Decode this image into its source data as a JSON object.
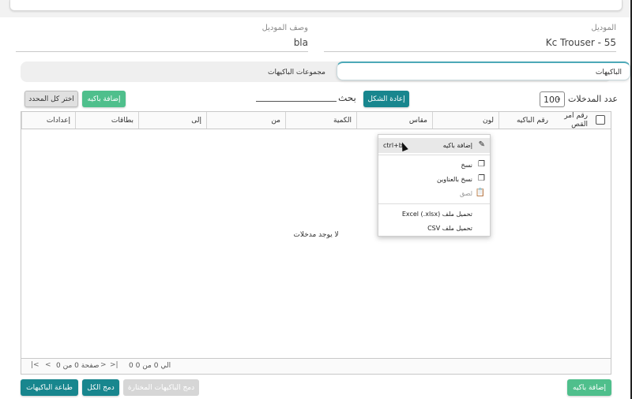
{
  "model_field": {
    "label": "الموديل",
    "value": "Kc Trouser - 55"
  },
  "model_desc_field": {
    "label": "وصف الموديل",
    "value": "bla"
  },
  "tabs": [
    {
      "label": "الباكيهات",
      "active": true
    },
    {
      "label": "مجموعات الباكيهات",
      "active": false
    }
  ],
  "toolbar": {
    "select_all_label": "اختر كل المحدد",
    "add_pack_label": "إضافة باكيه",
    "search_label": "بحث",
    "reset_label": "إعادة الشكل",
    "page_size": "100",
    "count_label": "عدد المدخلات"
  },
  "table": {
    "columns": [
      "رقم امر القص",
      "رقم الباكيه",
      "لون",
      "مقاس",
      "الكمية",
      "من",
      "إلى",
      "بطاقات",
      "إعدادات"
    ],
    "empty_text": "لا يوجد مدخلات",
    "footer": {
      "range_text": "0 الي 0 من 0",
      "page_text": "صفحة 0 من 0"
    }
  },
  "context_menu": {
    "items": [
      {
        "label": "إضافة باكيه",
        "shortcut": "ctrl+b",
        "icon": "edit-icon"
      },
      {
        "label": "نسخ",
        "icon": "copy-icon"
      },
      {
        "label": "نسخ بالعناوين",
        "icon": "copy-icon"
      },
      {
        "label": "لصق",
        "icon": "paste-icon"
      },
      {
        "label": "تحميل ملف (Excel (.xlsx"
      },
      {
        "label": "تحميل ملف CSV"
      }
    ]
  },
  "bottom_bar": {
    "print_label": "طباعة الباكيهات",
    "merge_all_label": "دمج الكل",
    "merge_selected_label": "دمج الباكيهات المختارة",
    "add_pack_label": "إضافة باكيه"
  },
  "colors": {
    "green": "#4fbf8c",
    "teal": "#18868e",
    "tab_accent": "#4da9b8"
  }
}
